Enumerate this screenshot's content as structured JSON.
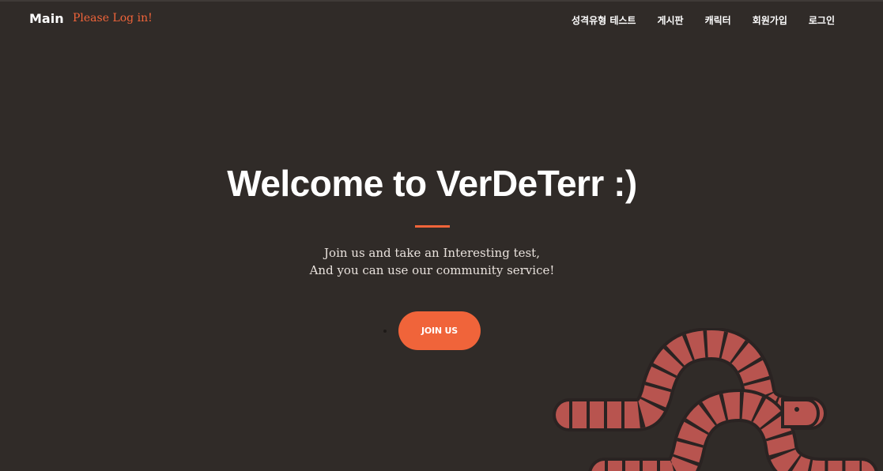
{
  "nav": {
    "brand": "Main",
    "login_hint": "Please Log in!",
    "menu": [
      {
        "label": "성격유형 테스트"
      },
      {
        "label": "게시판"
      },
      {
        "label": "캐릭터"
      },
      {
        "label": "회원가입"
      },
      {
        "label": "로그인"
      }
    ]
  },
  "hero": {
    "title": "Welcome to VerDeTerr :)",
    "subtitle_line1": "Join us and take an Interesting test,",
    "subtitle_line2": "And you can use our community service!",
    "button_label": "JOIN US"
  },
  "colors": {
    "background": "#302b28",
    "accent": "#f0643a",
    "worm_body": "#b8544f",
    "worm_outline": "#2a2322"
  },
  "decoration": {
    "illustration": "worms-illustration"
  }
}
